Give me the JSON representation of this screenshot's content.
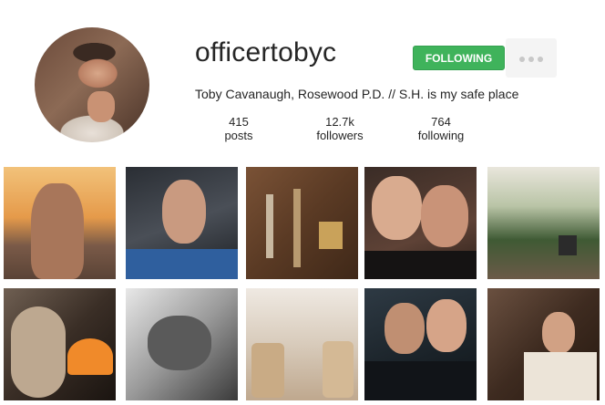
{
  "profile": {
    "username": "officertobyc",
    "bio": "Toby Cavanaugh, Rosewood P.D. // S.H. is my safe place",
    "follow_button": "FOLLOWING",
    "more_icon": "ellipsis-icon",
    "colors": {
      "follow_green": "#3fb35b",
      "text": "#262626",
      "more_bg": "#f4f4f4"
    }
  },
  "stats": [
    {
      "value": "415",
      "label": "posts"
    },
    {
      "value": "12.7k",
      "label": "followers"
    },
    {
      "value": "764",
      "label": "following"
    }
  ],
  "grid": {
    "rows": 2,
    "columns": 5
  }
}
